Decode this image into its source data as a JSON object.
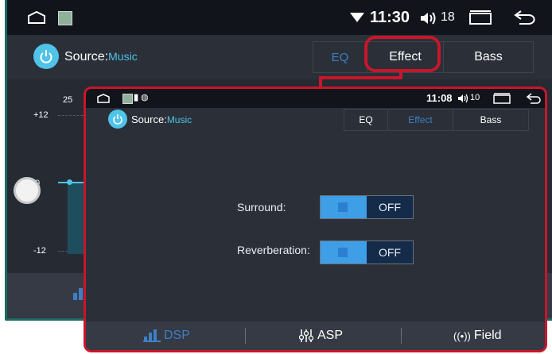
{
  "background_screen": {
    "status_bar": {
      "time": "11:30",
      "volume": "18"
    },
    "header": {
      "source_label": "Source:",
      "source_value": "Music"
    },
    "tabs": [
      {
        "label": "EQ"
      },
      {
        "label": "Effect"
      },
      {
        "label": "Bass"
      }
    ],
    "eq": {
      "top_value": "25",
      "plus_label": "+12",
      "zero_label": "0",
      "minus_label": "-12"
    }
  },
  "popup_screen": {
    "status_bar": {
      "time": "11:08",
      "volume": "10"
    },
    "header": {
      "source_label": "Source:",
      "source_value": "Music"
    },
    "tabs": [
      {
        "label": "EQ"
      },
      {
        "label": "Effect"
      },
      {
        "label": "Bass"
      }
    ],
    "settings": [
      {
        "label": "Surround:",
        "state": "OFF"
      },
      {
        "label": "Reverberation:",
        "state": "OFF"
      }
    ],
    "bottom_nav": [
      {
        "label": "DSP"
      },
      {
        "label": "ASP"
      },
      {
        "label": "Field"
      }
    ]
  },
  "colors": {
    "accent": "#4fc3e8",
    "highlight": "#c8162b",
    "frame": "#1a6b62",
    "dim_tab": "#3e7fc4"
  }
}
